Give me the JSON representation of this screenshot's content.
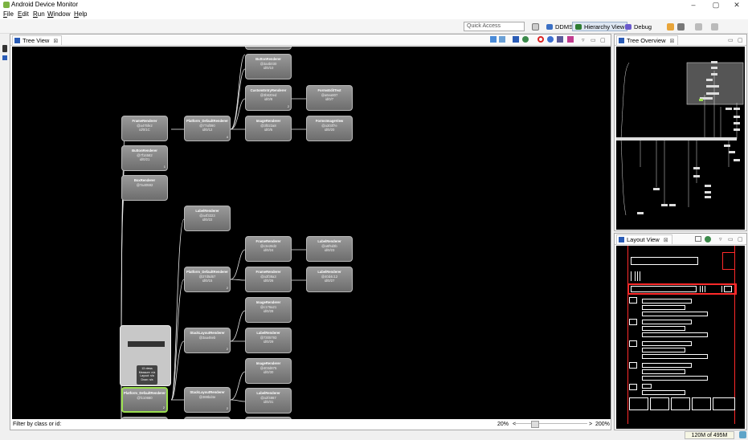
{
  "window": {
    "title": "Android Device Monitor",
    "minimize": "–",
    "maximize": "▢",
    "close": "✕"
  },
  "menu": [
    {
      "key": "F",
      "rest": "ile"
    },
    {
      "key": "E",
      "rest": "dit"
    },
    {
      "key": "R",
      "rest": "un"
    },
    {
      "key": "W",
      "rest": "indow"
    },
    {
      "key": "H",
      "rest": "elp"
    }
  ],
  "toolbar": {
    "quick_access_placeholder": "Quick Access",
    "perspectives": [
      {
        "label": "DDMS",
        "active": false,
        "color": "#3a6fc4"
      },
      {
        "label": "Hierarchy View",
        "active": true,
        "color": "#2e7d32"
      },
      {
        "label": "Debug",
        "active": false,
        "color": "#6a5acd"
      }
    ]
  },
  "tree_view": {
    "tab_label": "Tree View",
    "filter_label": "Filter by class or id:",
    "zoom_min": "20%",
    "zoom_max": "200%",
    "zoom_less": "<",
    "zoom_more": ">",
    "preview_info": [
      "13 views",
      "Measure: n/a",
      "Layout: n/a",
      "Draw: n/a"
    ],
    "nodes": [
      {
        "name": "ButtonRenderer",
        "id": "@3a4b030",
        "idx": "id/0/10"
      },
      {
        "name": "CustomEntryRenderer",
        "id": "@3b620ed",
        "idx": "id/0/8",
        "cnt": "2"
      },
      {
        "name": "FormsEditText",
        "id": "@a6ea807",
        "idx": "id/0/7"
      },
      {
        "name": "FrameRenderer",
        "id": "@a475fe2",
        "idx": "id/0/1C"
      },
      {
        "name": "Platform_DefaultRenderer",
        "id": "@77af090",
        "idx": "id/0/12",
        "cnt": "4"
      },
      {
        "name": "ImageRenderer",
        "id": "@3f022a8",
        "idx": "id/0/5"
      },
      {
        "name": "FormsImageView",
        "id": "@a303f7e",
        "idx": "id/0/20"
      },
      {
        "name": "ButtonRenderer",
        "id": "@7f16582",
        "idx": "id/0/21",
        "cnt": "1"
      },
      {
        "name": "BoxRenderer",
        "id": "@7a40592",
        "idx": ""
      },
      {
        "name": "LabelRenderer",
        "id": "@a4f3223",
        "idx": "id/0/22"
      },
      {
        "name": "FrameRenderer",
        "id": "@c3e28d2",
        "idx": "id/0/24"
      },
      {
        "name": "LabelRenderer",
        "id": "@a6f5d3b",
        "idx": "id/0/23"
      },
      {
        "name": "Platform_DefaultRenderer",
        "id": "@27d5d67",
        "idx": "id/0/15",
        "cnt": "2"
      },
      {
        "name": "FrameRenderer",
        "id": "@a3f38a3",
        "idx": "id/0/26"
      },
      {
        "name": "LabelRenderer",
        "id": "@40d4c12",
        "idx": "id/0/27"
      },
      {
        "name": "ImageRenderer",
        "id": "@c176a21",
        "idx": "id/0/28"
      },
      {
        "name": "StackLayoutRenderer",
        "id": "@3aa46eb",
        "idx": "",
        "cnt": "2"
      },
      {
        "name": "LabelRenderer",
        "id": "@7305793",
        "idx": "id/0/29"
      },
      {
        "name": "ImageRenderer",
        "id": "@403d875",
        "idx": "id/0/30"
      },
      {
        "name": "Platform_DefaultRenderer",
        "id": "@fc10660",
        "idx": "",
        "cnt": "2"
      },
      {
        "name": "StackLayoutRenderer",
        "id": "@388bd4e",
        "idx": "",
        "cnt": "2"
      },
      {
        "name": "LabelRenderer",
        "id": "@a2f4867",
        "idx": "id/0/31"
      }
    ]
  },
  "tree_overview": {
    "tab_label": "Tree Overview"
  },
  "layout_view": {
    "tab_label": "Layout View"
  },
  "status": {
    "heap": "120M of 495M"
  }
}
